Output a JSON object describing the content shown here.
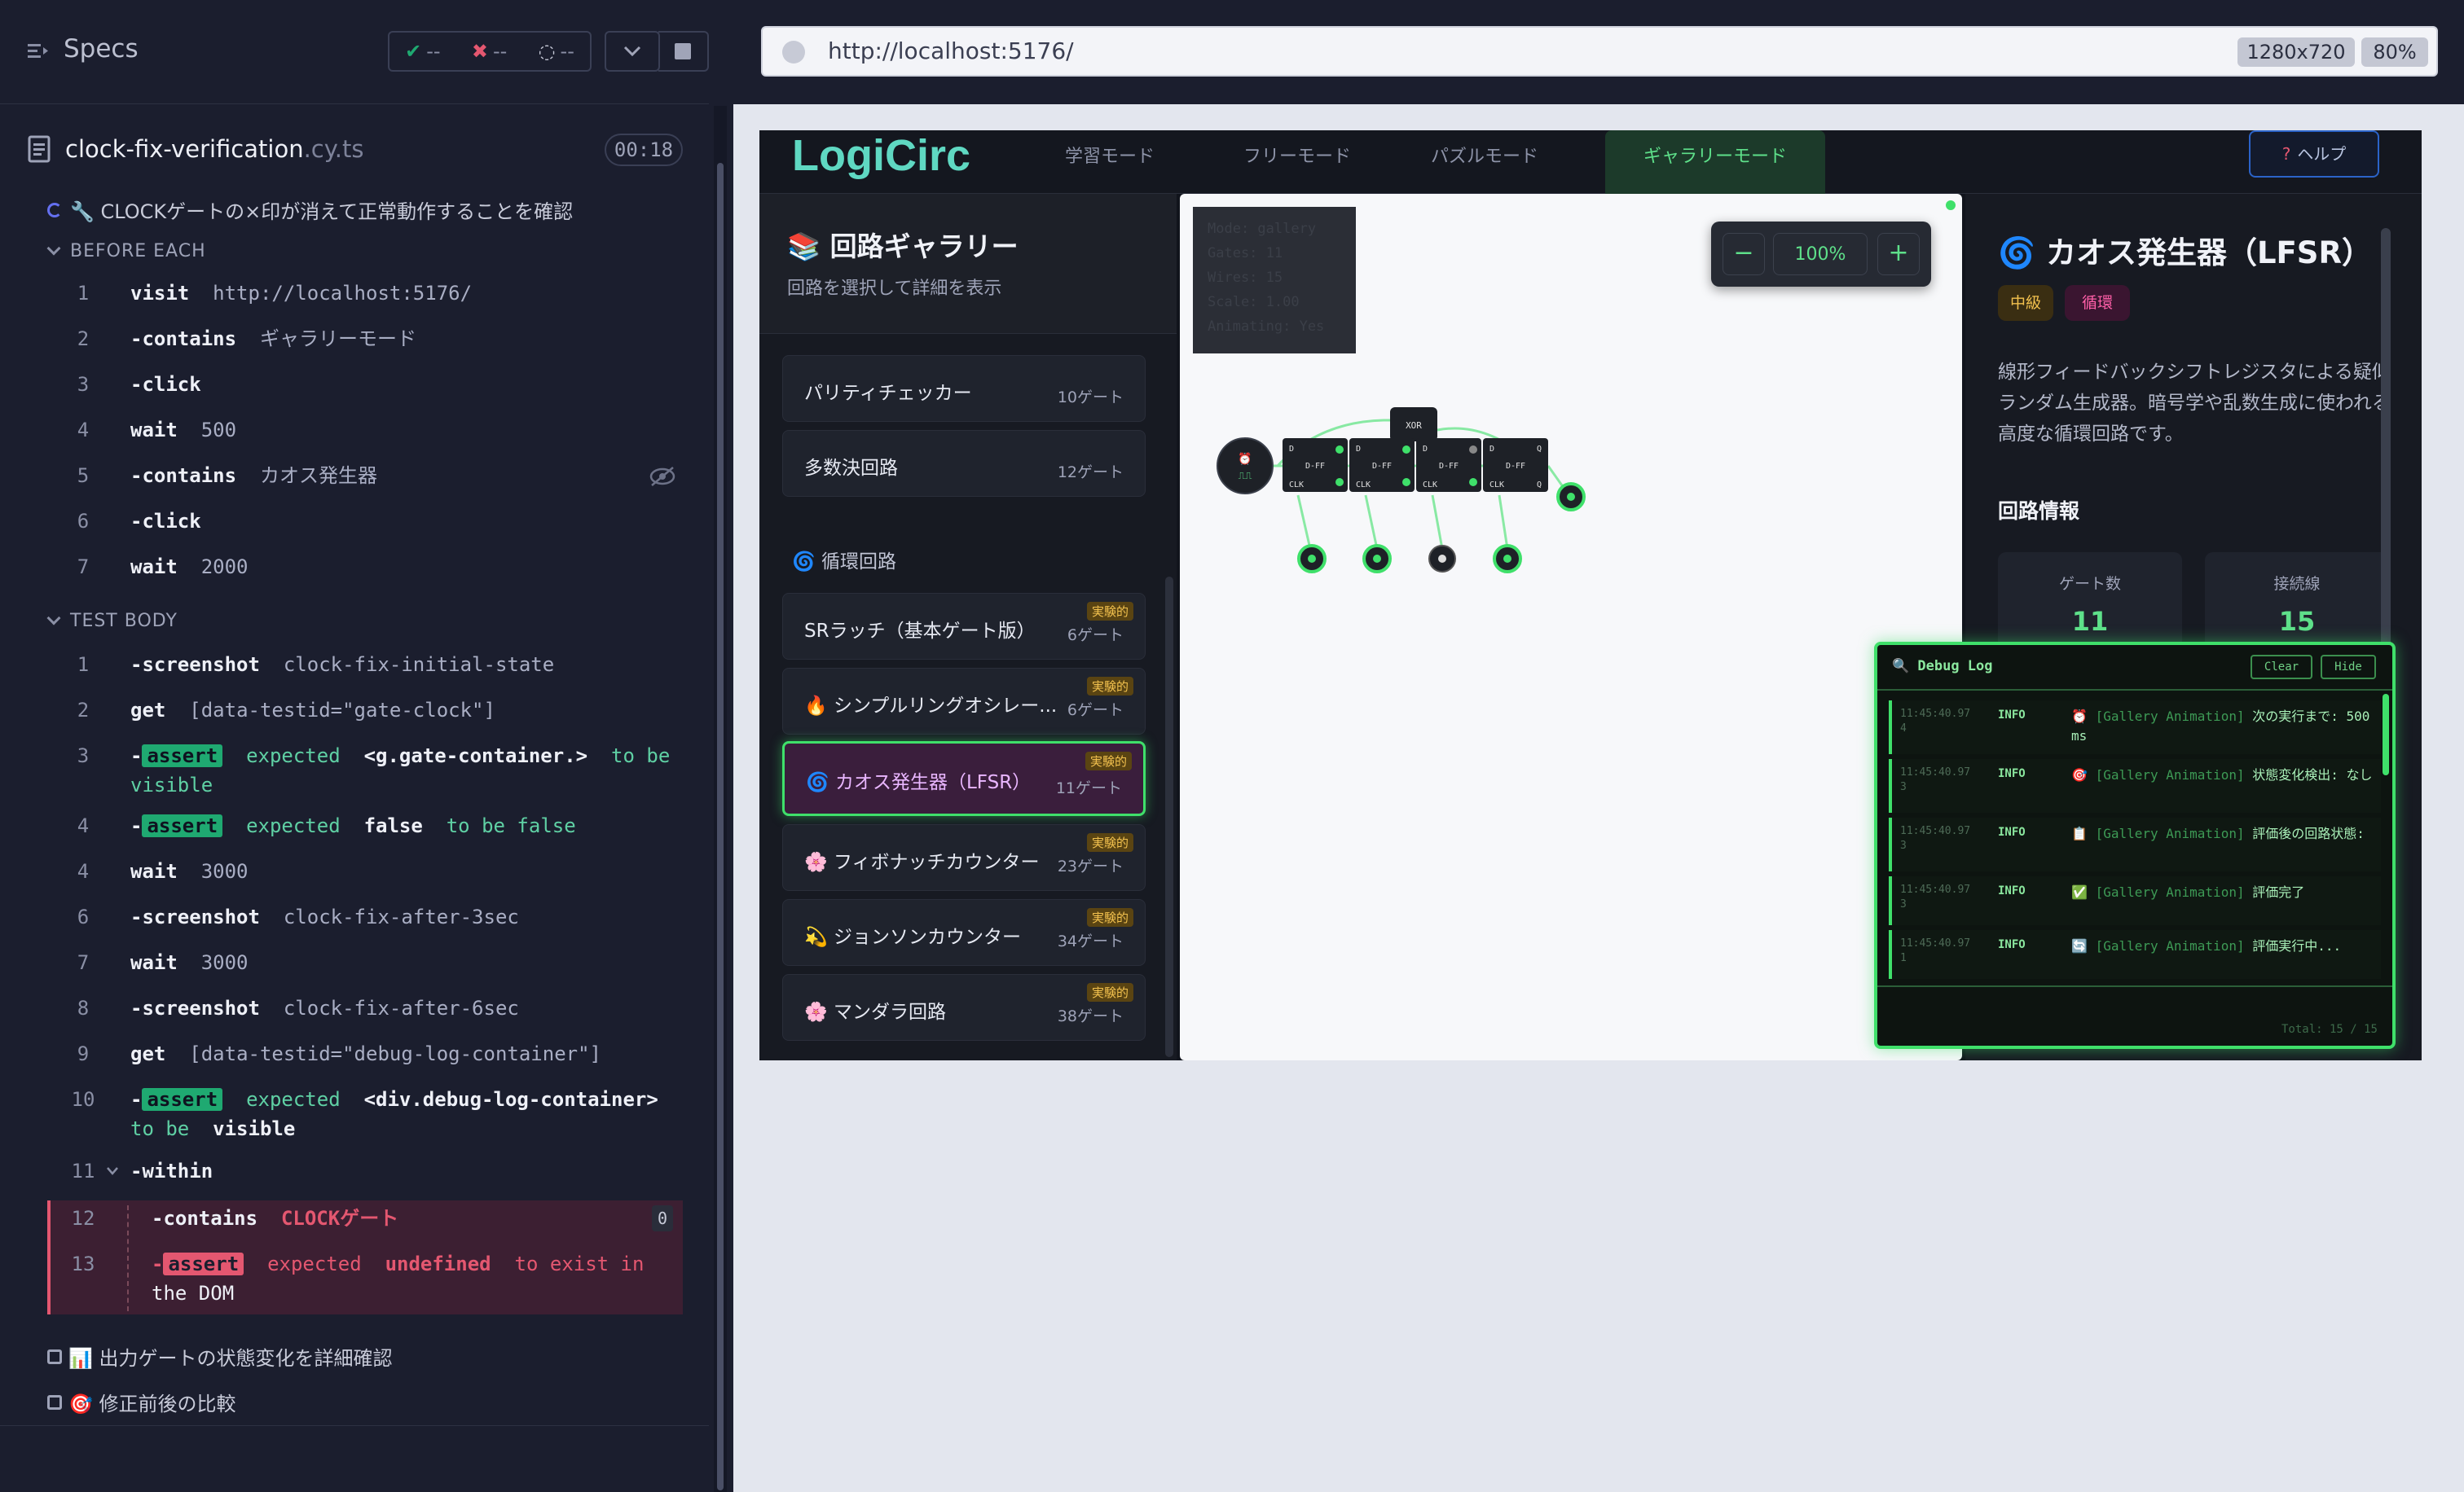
{
  "runner": {
    "specs_label": "Specs",
    "stats": {
      "passed": "--",
      "failed": "--",
      "pending": "--"
    },
    "spec_file": {
      "name": "clock-fix-verification",
      "ext": ".cy.ts",
      "duration": "00:18"
    },
    "suite_title": "🔧 CLOCKゲートの×印が消えて正常動作することを確認",
    "before_each_label": "BEFORE EACH",
    "before_each": [
      {
        "n": "1",
        "cmd": "visit",
        "arg": "http://localhost:5176/"
      },
      {
        "n": "2",
        "cmd": "-contains",
        "arg": "ギャラリーモード"
      },
      {
        "n": "3",
        "cmd": "-click",
        "arg": ""
      },
      {
        "n": "4",
        "cmd": "wait",
        "arg": "500"
      },
      {
        "n": "5",
        "cmd": "-contains",
        "arg": "カオス発生器"
      },
      {
        "n": "6",
        "cmd": "-click",
        "arg": ""
      },
      {
        "n": "7",
        "cmd": "wait",
        "arg": "2000"
      }
    ],
    "test_body_label": "TEST BODY",
    "test_body": [
      {
        "n": "1",
        "cmd": "-screenshot",
        "arg": "clock-fix-initial-state"
      },
      {
        "n": "2",
        "cmd": "get",
        "arg": "[data-testid=\"gate-clock\"]"
      },
      {
        "n": "4",
        "cmd": "wait",
        "arg": "3000"
      },
      {
        "n": "6",
        "cmd": "-screenshot",
        "arg": "clock-fix-after-3sec"
      },
      {
        "n": "7",
        "cmd": "wait",
        "arg": "3000"
      },
      {
        "n": "8",
        "cmd": "-screenshot",
        "arg": "clock-fix-after-6sec"
      },
      {
        "n": "9",
        "cmd": "get",
        "arg": "[data-testid=\"debug-log-container\"]"
      },
      {
        "n": "11",
        "cmd": "-within",
        "arg": ""
      }
    ],
    "assert3": {
      "n": "3",
      "badge": "assert",
      "text1": "expected",
      "val": "<g.gate-container.>",
      "text2": "to be",
      "text3": "visible"
    },
    "assert4": {
      "n": "4",
      "badge": "assert",
      "text1": "expected",
      "val": "false",
      "text2": "to be false"
    },
    "assert10": {
      "n": "10",
      "badge": "assert",
      "text1": "expected",
      "val": "<div.debug-log-container>",
      "text2": "to be",
      "text3": "visible"
    },
    "fail12": {
      "n": "12",
      "cmd": "-contains",
      "arg": "CLOCKゲート",
      "count": "0"
    },
    "fail13": {
      "n": "13",
      "badge": "assert",
      "text1": "expected",
      "val": "undefined",
      "text2": "to exist in",
      "text3": "the DOM"
    },
    "other_tests": [
      "📊 出力ゲートの状態変化を詳細確認",
      "🎯 修正前後の比較"
    ]
  },
  "browser": {
    "url": "http://localhost:5176/",
    "viewport": "1280x720",
    "zoom": "80%"
  },
  "app": {
    "logo": "LogiCirc",
    "tabs": [
      "学習モード",
      "フリーモード",
      "パズルモード",
      "ギャラリーモード"
    ],
    "active_tab": "ギャラリーモード",
    "help": "ヘルプ",
    "gallery": {
      "title": "📚 回路ギャラリー",
      "subtitle": "回路を選択して詳細を表示",
      "items_top": [
        {
          "name": "パリティチェッカー",
          "count": "10ゲート"
        },
        {
          "name": "多数決回路",
          "count": "12ゲート"
        }
      ],
      "category": "🌀 循環回路",
      "experimental_label": "実験的",
      "items_cyclic": [
        {
          "name": "SRラッチ（基本ゲート版）",
          "count": "6ゲート"
        },
        {
          "name": "🔥 シンプルリングオシレー...",
          "count": "6ゲート"
        },
        {
          "name": "🌀 カオス発生器（LFSR）",
          "count": "11ゲート"
        },
        {
          "name": "🌸 フィボナッチカウンター",
          "count": "23ゲート"
        },
        {
          "name": "💫 ジョンソンカウンター",
          "count": "34ゲート"
        },
        {
          "name": "🌸 マンダラ回路",
          "count": "38ゲート"
        }
      ]
    },
    "canvas": {
      "debug_overlay": [
        "Mode: gallery",
        "Gates: 11",
        "Wires: 15",
        "Scale: 1.00",
        "Animating: Yes"
      ],
      "zoom": "100%",
      "zoom_out": "−",
      "zoom_in": "+",
      "gate_labels": {
        "xor": "XOR",
        "dff": "D-FF",
        "d": "D",
        "clk": "CLK",
        "q": "Q"
      }
    },
    "detail": {
      "title": "🌀 カオス発生器（LFSR）",
      "tags": [
        "中級",
        "循環"
      ],
      "description": "線形フィードバックシフトレジスタによる疑似ランダム生成器。暗号学や乱数生成に使われる高度な循環回路です。",
      "info_heading": "回路情報",
      "stats": [
        {
          "label": "ゲート数",
          "value": "11"
        },
        {
          "label": "接続線",
          "value": "15"
        }
      ]
    },
    "debug_log": {
      "title": "🔍 Debug Log",
      "clear": "Clear",
      "hide": "Hide",
      "entries": [
        {
          "ts": "11:45:40.97 4",
          "level": "INFO",
          "icon": "⏰",
          "src": "[Gallery Animation]",
          "msg": "次の実行まで: 500 ms"
        },
        {
          "ts": "11:45:40.97 3",
          "level": "INFO",
          "icon": "🎯",
          "src": "[Gallery Animation]",
          "msg": "状態変化検出: なし"
        },
        {
          "ts": "11:45:40.97 3",
          "level": "INFO",
          "icon": "📋",
          "src": "[Gallery Animation]",
          "msg": "評価後の回路状態:"
        },
        {
          "ts": "11:45:40.97 3",
          "level": "INFO",
          "icon": "✅",
          "src": "[Gallery Animation]",
          "msg": "評価完了"
        },
        {
          "ts": "11:45:40.97 1",
          "level": "INFO",
          "icon": "🔄",
          "src": "[Gallery Animation]",
          "msg": "評価実行中..."
        }
      ],
      "total": "Total: 15 / 15"
    }
  }
}
